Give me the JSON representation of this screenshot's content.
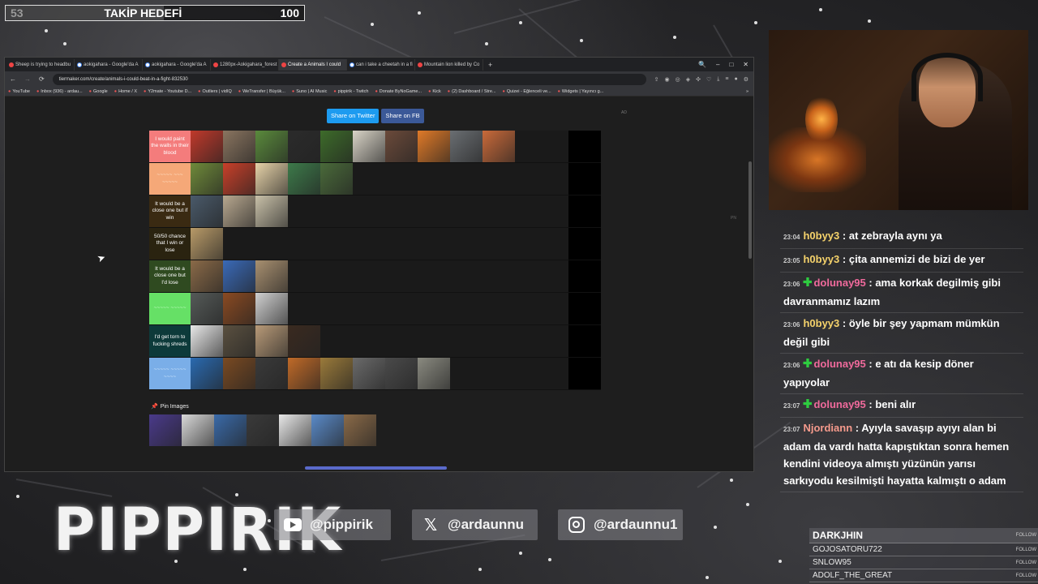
{
  "goal": {
    "current": "53",
    "label": "TAKİP HEDEFİ",
    "max": "100",
    "progress_fraction": 0.53
  },
  "browser": {
    "tabs": [
      "Sheep is trying to headbu",
      "aokigahara - Google'da A",
      "aokigahara - Google'da A",
      "1280px-Aokigahara_forest",
      "Create a Animals I could",
      "can i take a cheetah in a fi",
      "Mountain lion killed by Co"
    ],
    "active_tab_index": 4,
    "new_tab": "+",
    "window_controls": [
      "🔍",
      "–",
      "□",
      "✕"
    ],
    "url": "tiermaker.com/create/animals-i-could-beat-in-a-fight-832530",
    "bookmarks": [
      "YouTube",
      "Inbox (936) - ardau...",
      "Google",
      "Home / X",
      "Y2mate - Youtube D...",
      "Outliers | vidIQ",
      "WeTransfer | Büyük...",
      "Suno | AI Music",
      "pippirik - Twitch",
      "Donate ByNoGame...",
      "Kick",
      "(2) Dashboard / Stre...",
      "Quizei - Eğlenceli ve...",
      "Widgets | Yayıncı g..."
    ],
    "more_bookmarks": "»"
  },
  "page": {
    "share_twitter": "Share on Twitter",
    "share_fb": "Share on FB",
    "ad_label": "AD",
    "pn_label": "PN",
    "cursor": "➤",
    "pin_images_label": "Pin Images",
    "pin_icon": "📌"
  },
  "tiers": [
    {
      "label": "I would paint the walls in their blood",
      "color": "#f47c7c",
      "text_color": "#ffffff",
      "tiles": [
        "#c0392b",
        "#8a7560",
        "#5a8a3c",
        "#2b2b2b",
        "#3d6b2a",
        "#d9d4c7",
        "#6b4a3a",
        "#e07a28",
        "#6a6e72",
        "#c96a3a"
      ]
    },
    {
      "label": "~~~~~ ~~~ ~~~~~",
      "color": "#f5a878",
      "text_color": "#ffe7cf",
      "tiles": [
        "#6f8a3a",
        "#c8402a",
        "#e6d2a8",
        "#3d7a4a",
        "#4a6a3a"
      ]
    },
    {
      "label": "It would be a close one but if win",
      "color": "#3a2a12",
      "text_color": "#ffffff",
      "tiles": [
        "#4a5a6a",
        "#b8a890",
        "#c8c0a8"
      ]
    },
    {
      "label": "50/50 chance that I win or lose",
      "color": "#2a2310",
      "text_color": "#ffffff",
      "tiles": [
        "#b89a68"
      ]
    },
    {
      "label": "It would be a close one but I'd lose",
      "color": "#2f4a20",
      "text_color": "#ffffff",
      "tiles": [
        "#8a6a48",
        "#3a6ab8",
        "#a89070"
      ]
    },
    {
      "label": "~~~~~ ~~~~~",
      "color": "#66e066",
      "text_color": "#c8ffc8",
      "tiles": [
        "#555a58",
        "#8a4a22",
        "#d0d0d0"
      ]
    },
    {
      "label": "I'd get torn to fucking shreds",
      "color": "#0d3a3a",
      "text_color": "#ffffff",
      "tiles": [
        "#e8e8e8",
        "#5a5040",
        "#b89a78",
        "#3a2a20"
      ]
    },
    {
      "label": "~~~~~ ~~~~~ ~~~~",
      "color": "#7aaee8",
      "text_color": "#d8ecff",
      "tiles": [
        "#2a6ab0",
        "#7a4a22",
        "#3a3a3a",
        "#c06a28",
        "#9a7a3a",
        "#6a6a6a",
        "#4a4a4a",
        "#8a8a80"
      ]
    }
  ],
  "pins": [
    "#4a3a8a",
    "#d8d8d8",
    "#3a6aa8",
    "#3a3a3a",
    "#e8e8e8",
    "#5a8ac8",
    "#8a6a48"
  ],
  "chat": [
    {
      "time": "23:04",
      "badge": false,
      "user": "h0byy3",
      "color": "yellow",
      "text": "at zebrayla aynı ya"
    },
    {
      "time": "23:05",
      "badge": false,
      "user": "h0byy3",
      "color": "yellow",
      "text": "çita annemizi de bizi de yer"
    },
    {
      "time": "23:06",
      "badge": true,
      "user": "dolunay95",
      "color": "pink",
      "text": "ama korkak degilmiş gibi davranmamız lazım"
    },
    {
      "time": "23:06",
      "badge": false,
      "user": "h0byy3",
      "color": "yellow",
      "text": "öyle bir şey yapmam mümkün değil gibi"
    },
    {
      "time": "23:06",
      "badge": true,
      "user": "dolunay95",
      "color": "pink",
      "text": "e atı da kesip döner yapıyolar"
    },
    {
      "time": "23:07",
      "badge": true,
      "user": "dolunay95",
      "color": "pink",
      "text": "beni alır"
    },
    {
      "time": "23:07",
      "badge": false,
      "user": "Njordiann",
      "color": "salmon",
      "text": "Ayıyla savaşıp ayıyı alan bi adam da vardı hatta kapıştıktan sonra hemen kendini videoya almıştı yüzünün yarısı sarkıyodu kesilmişti hayatta kalmıştı o adam"
    }
  ],
  "branding": {
    "logo": "PIPPIRIK"
  },
  "socials": [
    {
      "icon": "youtube-icon",
      "handle": "@pippirik"
    },
    {
      "icon": "x-icon",
      "handle": "@ardaunnu",
      "glyph": "𝕏"
    },
    {
      "icon": "instagram-icon",
      "handle": "@ardaunnu1"
    }
  ],
  "followers": {
    "tag": "FOLLOW",
    "names": [
      "DARKJHIN",
      "GOJOSATORU722",
      "SNLOW95",
      "ADOLF_THE_GREAT"
    ]
  }
}
